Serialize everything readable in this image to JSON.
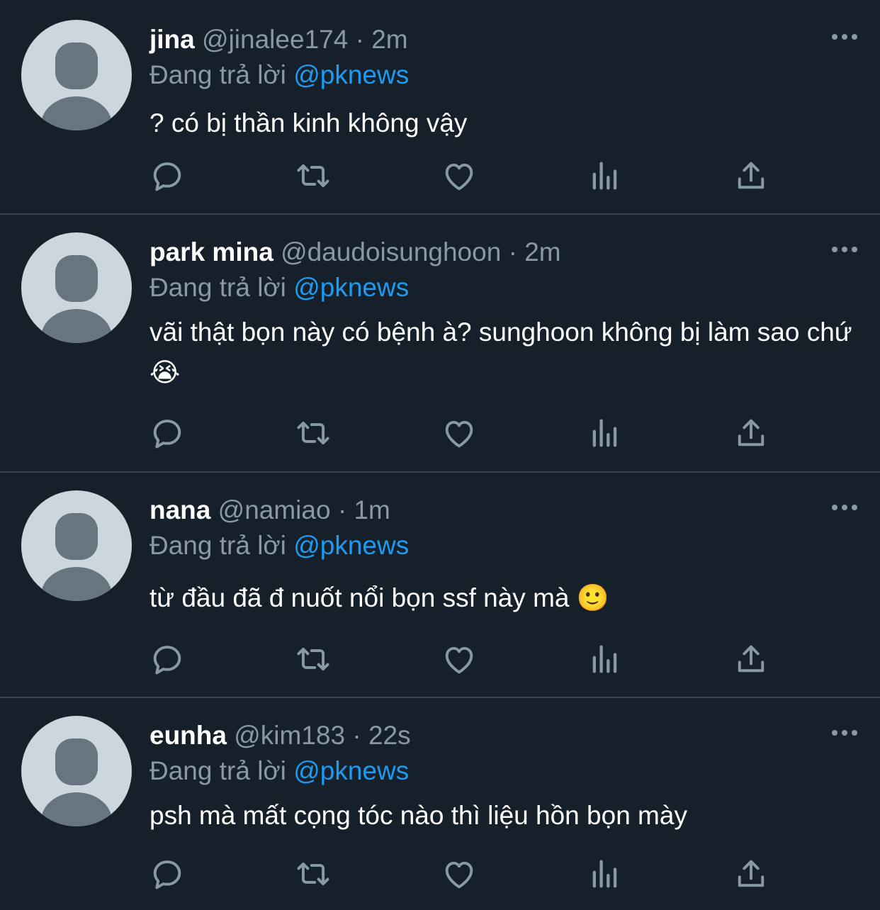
{
  "colors": {
    "background": "#15202b",
    "divider": "#38444d",
    "secondary_text": "#8899a6",
    "mention": "#1d9bf0",
    "avatar_bg": "#ccd6dd",
    "avatar_fg": "#66757f"
  },
  "tweets": [
    {
      "name": "jina",
      "handle": "@jinalee174",
      "dot": "·",
      "time": "2m",
      "reply_prefix": "Đang trả lời",
      "reply_to": "@pknews",
      "text": "? có bị thần kinh không vậy"
    },
    {
      "name": "park mina",
      "handle": "@daudoisunghoon",
      "dot": "·",
      "time": "2m",
      "reply_prefix": "Đang trả lời",
      "reply_to": "@pknews",
      "text": "vãi thật bọn này có bệnh à? sunghoon không bị làm sao chứ 😭"
    },
    {
      "name": "nana",
      "handle": "@namiao",
      "dot": "·",
      "time": "1m",
      "reply_prefix": "Đang trả lời",
      "reply_to": "@pknews",
      "text": "từ đầu đã đ nuốt nổi bọn ssf này mà 🙂"
    },
    {
      "name": "eunha",
      "handle": "@kim183",
      "dot": "·",
      "time": "22s",
      "reply_prefix": "Đang trả lời",
      "reply_to": "@pknews",
      "text": "psh mà mất cọng tóc nào thì liệu hồn bọn mày"
    }
  ],
  "icons": [
    "reply-icon",
    "retweet-icon",
    "like-icon",
    "analytics-icon",
    "share-icon",
    "more-icon"
  ]
}
